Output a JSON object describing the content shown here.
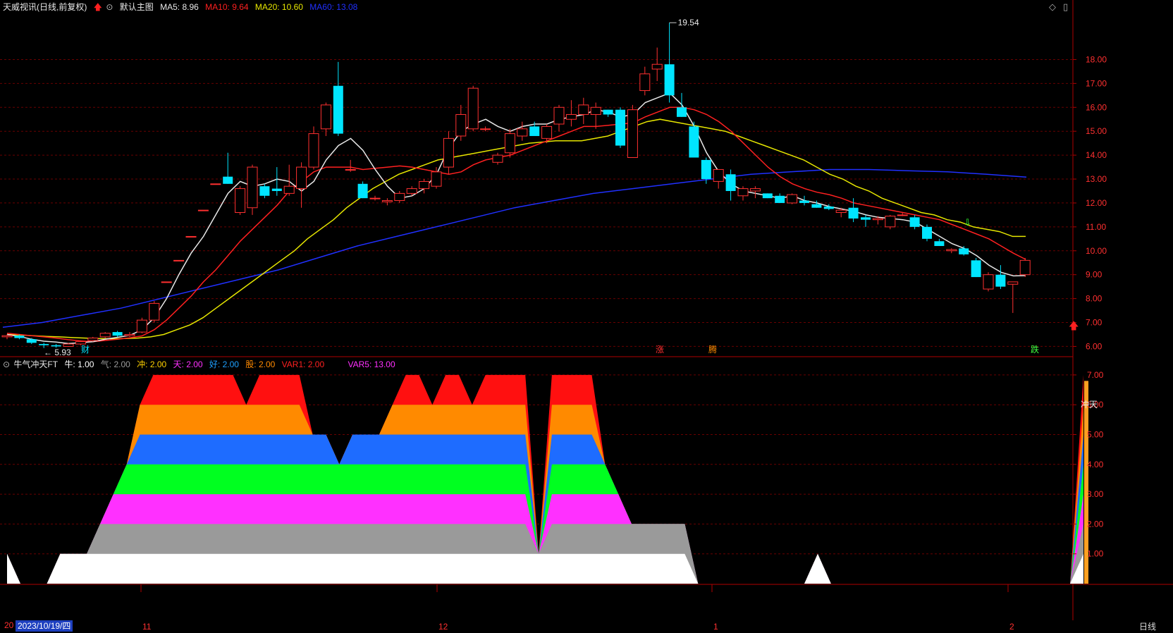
{
  "header": {
    "title": "天威视讯(日线,前复权)",
    "main_label": "默认主图",
    "ma": [
      {
        "label": "MA5: 8.96",
        "color": "#e8e8e8"
      },
      {
        "label": "MA10: 9.64",
        "color": "#ff2020"
      },
      {
        "label": "MA20: 10.60",
        "color": "#e6e600"
      },
      {
        "label": "MA60: 13.08",
        "color": "#2030ff"
      }
    ]
  },
  "sub_header": {
    "title": "牛气冲天FT",
    "items": [
      {
        "label": "牛: 1.00",
        "color": "#ffffff"
      },
      {
        "label": "气: 2.00",
        "color": "#9a9a9a"
      },
      {
        "label": "冲: 2.00",
        "color": "#ffd200"
      },
      {
        "label": "天: 2.00",
        "color": "#ff30ff"
      },
      {
        "label": "好: 2.00",
        "color": "#1ea0ff"
      },
      {
        "label": "股: 2.00",
        "color": "#ff8a00"
      },
      {
        "label": "VAR1: 2.00",
        "color": "#ff2020"
      },
      {
        "label": "VAR5: 13.00",
        "color": "#ff30ff"
      }
    ]
  },
  "price_axis": [
    "18.00",
    "17.00",
    "16.00",
    "15.00",
    "14.00",
    "13.00",
    "12.00",
    "11.00",
    "10.00",
    "9.00",
    "8.00",
    "7.00",
    "6.00"
  ],
  "sub_axis": [
    "7.00",
    "6.00",
    "5.00",
    "4.00",
    "3.00",
    "2.00",
    "1.00"
  ],
  "annotations": {
    "high": "19.54",
    "low": "5.93",
    "marker_cai": "财",
    "marker_zhang": "涨",
    "marker_teng": "腾",
    "marker_die": "跌",
    "chongtian": "冲天"
  },
  "x_axis": {
    "date": "2023/10/19/四",
    "prefix": "20",
    "months": [
      "11",
      "12",
      "1",
      "2"
    ]
  },
  "period": "日线",
  "colors": {
    "up": "#ff3030",
    "down": "#00e5ff",
    "grid": "#7a0000"
  },
  "chart_data": {
    "type": "candlestick",
    "ylim": [
      5.6,
      19.9
    ],
    "candles": [
      [
        6.4,
        6.5,
        6.3,
        6.45
      ],
      [
        6.45,
        6.5,
        6.3,
        6.35
      ],
      [
        6.3,
        6.35,
        6.1,
        6.15
      ],
      [
        6.1,
        6.15,
        5.93,
        6.05
      ],
      [
        6.05,
        6.1,
        5.95,
        6.0
      ],
      [
        6.0,
        6.15,
        5.98,
        6.1
      ],
      [
        6.1,
        6.25,
        6.05,
        6.2
      ],
      [
        6.25,
        6.4,
        6.2,
        6.35
      ],
      [
        6.4,
        6.6,
        6.35,
        6.55
      ],
      [
        6.6,
        6.65,
        6.4,
        6.45
      ],
      [
        6.45,
        6.6,
        6.4,
        6.5
      ],
      [
        6.6,
        7.2,
        6.55,
        7.1
      ],
      [
        7.1,
        7.9,
        7.0,
        7.8
      ],
      [
        8.7,
        8.7,
        8.7,
        8.7
      ],
      [
        9.6,
        9.6,
        9.6,
        9.6
      ],
      [
        10.6,
        10.6,
        10.6,
        10.6
      ],
      [
        11.7,
        11.7,
        11.7,
        11.7
      ],
      [
        12.8,
        12.8,
        12.8,
        12.8
      ],
      [
        13.1,
        14.1,
        12.8,
        12.8
      ],
      [
        11.6,
        12.7,
        11.5,
        12.6
      ],
      [
        11.8,
        13.6,
        11.5,
        13.5
      ],
      [
        12.7,
        12.8,
        12.2,
        12.3
      ],
      [
        12.6,
        13.5,
        12.3,
        12.5
      ],
      [
        12.4,
        13.6,
        12.3,
        12.7
      ],
      [
        12.6,
        13.7,
        11.8,
        13.5
      ],
      [
        13.5,
        15.2,
        13.4,
        14.9
      ],
      [
        15.1,
        16.2,
        14.8,
        16.1
      ],
      [
        16.9,
        17.9,
        14.8,
        14.9
      ],
      [
        13.4,
        13.8,
        13.3,
        13.4
      ],
      [
        12.8,
        12.9,
        12.2,
        12.2
      ],
      [
        12.2,
        12.3,
        12.1,
        12.2
      ],
      [
        12.05,
        12.2,
        11.9,
        12.1
      ],
      [
        12.1,
        12.5,
        12.0,
        12.4
      ],
      [
        12.4,
        12.7,
        12.3,
        12.6
      ],
      [
        12.6,
        13.0,
        12.4,
        12.9
      ],
      [
        12.7,
        13.5,
        12.6,
        13.3
      ],
      [
        13.5,
        15.0,
        13.2,
        14.7
      ],
      [
        14.8,
        16.1,
        14.6,
        15.7
      ],
      [
        15.1,
        16.9,
        15.0,
        16.8
      ],
      [
        15.1,
        15.2,
        15.0,
        15.1
      ],
      [
        13.7,
        14.1,
        13.6,
        14.0
      ],
      [
        14.1,
        15.1,
        13.9,
        14.9
      ],
      [
        14.8,
        15.4,
        14.6,
        15.1
      ],
      [
        15.2,
        15.4,
        14.9,
        14.8
      ],
      [
        14.7,
        15.3,
        14.5,
        15.2
      ],
      [
        15.3,
        16.1,
        15.0,
        16.0
      ],
      [
        15.5,
        16.3,
        15.2,
        15.7
      ],
      [
        15.7,
        16.4,
        15.3,
        16.1
      ],
      [
        15.7,
        16.2,
        15.1,
        16.0
      ],
      [
        15.9,
        15.9,
        15.6,
        15.7
      ],
      [
        15.9,
        16.0,
        14.3,
        14.4
      ],
      [
        13.9,
        16.1,
        13.9,
        15.9
      ],
      [
        16.7,
        17.7,
        16.5,
        17.4
      ],
      [
        17.6,
        18.5,
        17.1,
        17.8
      ],
      [
        17.8,
        19.54,
        16.2,
        16.5
      ],
      [
        16.0,
        16.6,
        15.6,
        15.6
      ],
      [
        15.2,
        15.4,
        13.9,
        13.9
      ],
      [
        13.8,
        13.9,
        12.8,
        13.0
      ],
      [
        12.9,
        13.4,
        12.6,
        13.4
      ],
      [
        13.2,
        13.4,
        12.1,
        12.5
      ],
      [
        12.3,
        12.7,
        12.1,
        12.6
      ],
      [
        12.5,
        12.7,
        12.2,
        12.6
      ],
      [
        12.4,
        12.4,
        12.2,
        12.2
      ],
      [
        12.3,
        12.4,
        12.0,
        12.0
      ],
      [
        12.0,
        12.4,
        11.95,
        12.35
      ],
      [
        12.1,
        12.3,
        11.9,
        12.0
      ],
      [
        11.95,
        12.1,
        11.8,
        11.8
      ],
      [
        11.85,
        11.95,
        11.7,
        11.75
      ],
      [
        11.6,
        11.8,
        11.4,
        11.7
      ],
      [
        11.8,
        12.2,
        11.2,
        11.35
      ],
      [
        11.4,
        11.5,
        11.0,
        11.3
      ],
      [
        11.3,
        11.45,
        11.1,
        11.35
      ],
      [
        11.0,
        11.5,
        10.9,
        11.45
      ],
      [
        11.5,
        11.6,
        11.45,
        11.5
      ],
      [
        11.4,
        11.5,
        10.9,
        11.0
      ],
      [
        11.0,
        11.1,
        10.4,
        10.5
      ],
      [
        10.4,
        10.5,
        10.2,
        10.2
      ],
      [
        10.0,
        10.1,
        9.9,
        10.05
      ],
      [
        10.1,
        10.2,
        9.8,
        9.85
      ],
      [
        9.6,
        9.7,
        8.9,
        8.9
      ],
      [
        8.4,
        9.1,
        8.3,
        9.0
      ],
      [
        9.0,
        9.4,
        8.4,
        8.5
      ],
      [
        8.6,
        8.7,
        7.4,
        8.7
      ],
      [
        9.0,
        9.7,
        8.9,
        9.6
      ]
    ],
    "ma5": [
      6.5,
      6.42,
      6.3,
      6.22,
      6.18,
      6.12,
      6.15,
      6.2,
      6.3,
      6.38,
      6.46,
      6.7,
      7.2,
      8.0,
      9.0,
      9.9,
      10.6,
      11.5,
      12.4,
      12.9,
      12.7,
      12.8,
      13.0,
      12.9,
      12.5,
      12.9,
      13.8,
      14.4,
      14.7,
      14.2,
      13.4,
      12.7,
      12.2,
      12.3,
      12.6,
      13.2,
      14.3,
      15.0,
      15.3,
      15.5,
      15.2,
      15.0,
      15.2,
      15.3,
      15.3,
      15.5,
      15.6,
      15.7,
      15.9,
      15.8,
      15.6,
      15.7,
      16.2,
      16.4,
      16.6,
      16.1,
      15.2,
      14.1,
      13.3,
      12.8,
      12.5,
      12.4,
      12.3,
      12.2,
      12.3,
      12.1,
      12.0,
      11.85,
      11.75,
      11.65,
      11.5,
      11.4,
      11.35,
      11.3,
      11.2,
      10.9,
      10.6,
      10.3,
      10.1,
      9.8,
      9.4,
      9.1,
      8.95,
      8.96
    ],
    "ma10": [
      6.55,
      6.5,
      6.45,
      6.4,
      6.35,
      6.28,
      6.23,
      6.2,
      6.25,
      6.3,
      6.36,
      6.44,
      6.7,
      7.1,
      7.6,
      8.1,
      8.7,
      9.2,
      9.8,
      10.4,
      10.9,
      11.4,
      11.9,
      12.5,
      12.9,
      13.3,
      13.5,
      13.5,
      13.5,
      13.4,
      13.45,
      13.5,
      13.55,
      13.5,
      13.4,
      13.3,
      13.2,
      13.3,
      13.6,
      13.8,
      13.9,
      14.0,
      14.2,
      14.4,
      14.6,
      14.8,
      15.0,
      15.2,
      15.2,
      15.25,
      15.3,
      15.35,
      15.6,
      15.8,
      16.0,
      16.0,
      15.9,
      15.7,
      15.4,
      15.0,
      14.5,
      14.0,
      13.5,
      13.1,
      12.8,
      12.6,
      12.45,
      12.35,
      12.2,
      12.0,
      11.9,
      11.8,
      11.7,
      11.6,
      11.5,
      11.4,
      11.3,
      11.1,
      10.9,
      10.7,
      10.5,
      10.2,
      9.9,
      9.64
    ],
    "ma20": [
      6.5,
      6.48,
      6.45,
      6.42,
      6.4,
      6.37,
      6.35,
      6.33,
      6.32,
      6.33,
      6.35,
      6.4,
      6.5,
      6.7,
      6.9,
      7.2,
      7.6,
      8.0,
      8.4,
      8.8,
      9.2,
      9.6,
      10.0,
      10.5,
      10.9,
      11.3,
      11.8,
      12.2,
      12.6,
      12.9,
      13.2,
      13.4,
      13.6,
      13.8,
      13.9,
      14.0,
      14.1,
      14.2,
      14.3,
      14.4,
      14.5,
      14.55,
      14.6,
      14.6,
      14.6,
      14.7,
      14.8,
      15.0,
      15.2,
      15.4,
      15.5,
      15.4,
      15.3,
      15.2,
      15.1,
      15.0,
      14.8,
      14.6,
      14.4,
      14.2,
      14.0,
      13.8,
      13.5,
      13.2,
      13.0,
      12.7,
      12.5,
      12.2,
      12.0,
      11.8,
      11.6,
      11.5,
      11.3,
      11.2,
      11.0,
      10.9,
      10.8,
      10.6,
      10.6
    ],
    "ma60": [
      6.8,
      7.0,
      7.3,
      7.6,
      8.0,
      8.4,
      8.8,
      9.2,
      9.7,
      10.2,
      10.6,
      11.0,
      11.4,
      11.8,
      12.1,
      12.4,
      12.6,
      12.8,
      13.0,
      13.2,
      13.3,
      13.4,
      13.4,
      13.35,
      13.3,
      13.2,
      13.08
    ],
    "sub_levels": [
      1,
      0,
      0,
      0,
      1,
      1,
      1,
      2,
      3,
      4,
      6,
      7,
      7,
      7,
      7,
      7,
      7,
      7,
      6,
      7,
      7,
      7,
      7,
      5,
      5,
      4,
      5,
      5,
      5,
      6,
      7,
      7,
      6,
      7,
      7,
      6,
      7,
      7,
      7,
      7,
      1,
      7,
      7,
      7,
      7,
      4,
      3,
      2,
      2,
      2,
      2,
      2,
      0,
      0,
      0,
      0,
      0,
      0,
      0,
      0,
      0,
      1,
      0,
      0,
      0,
      0,
      0,
      0,
      0,
      0,
      0,
      0,
      0,
      0,
      0,
      0,
      0,
      0,
      0,
      0,
      0,
      7
    ]
  }
}
